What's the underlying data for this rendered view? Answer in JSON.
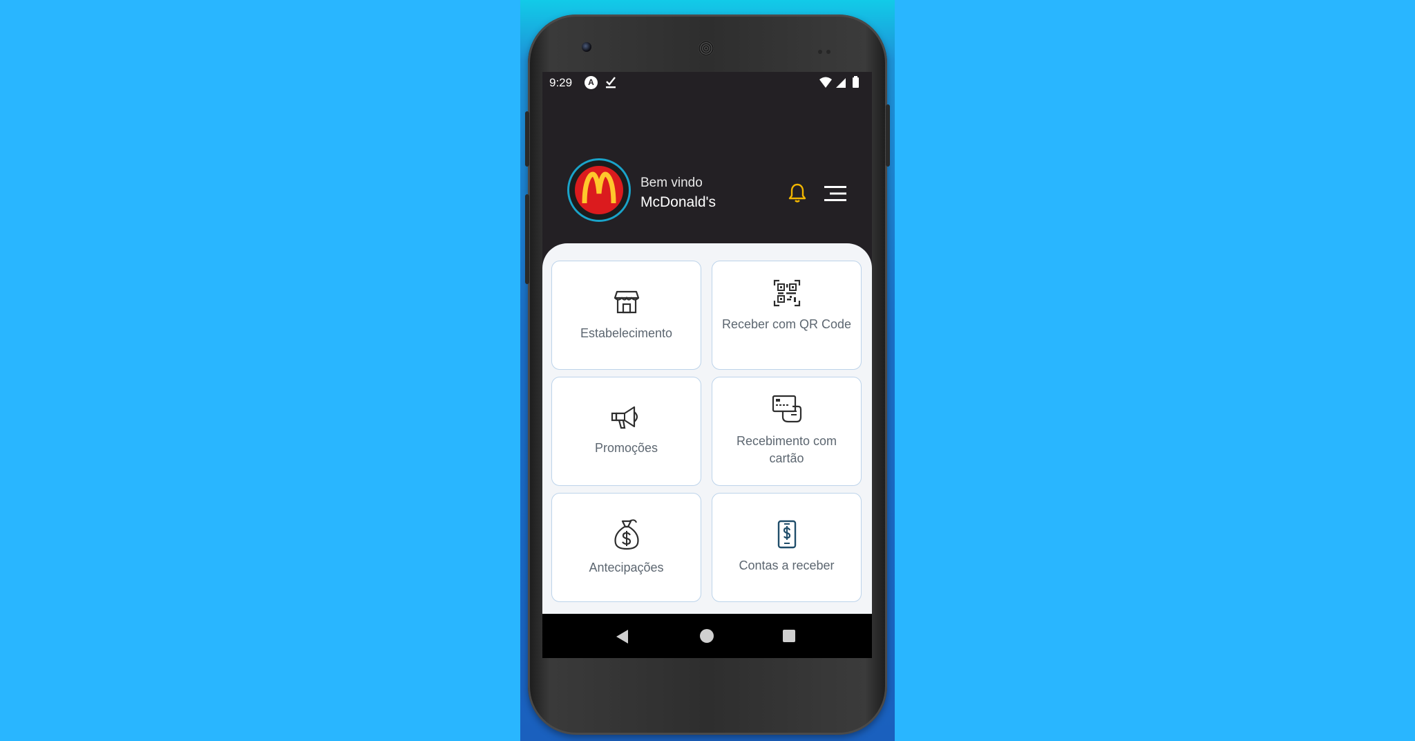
{
  "status_bar": {
    "time": "9:29",
    "a_badge": "A"
  },
  "header": {
    "welcome": "Bem vindo",
    "brand_name": "McDonald's",
    "logo_letter": "M"
  },
  "menu": {
    "items": [
      {
        "label": "Estabelecimento",
        "icon": "storefront-icon"
      },
      {
        "label": "Receber com QR Code",
        "icon": "qr-code-icon"
      },
      {
        "label": "Promoções",
        "icon": "megaphone-icon"
      },
      {
        "label": "Recebimento com cartão",
        "icon": "card-in-hand-icon"
      },
      {
        "label": "Antecipações",
        "icon": "money-bag-icon"
      },
      {
        "label": "Contas a receber",
        "icon": "phone-dollar-icon"
      }
    ]
  },
  "colors": {
    "background": "#29b6ff",
    "screen_dark": "#232024",
    "logo_red": "#db1b1e",
    "logo_yellow": "#ffc72c",
    "bell_yellow": "#f2b600",
    "card_border": "#bcd3ea"
  }
}
